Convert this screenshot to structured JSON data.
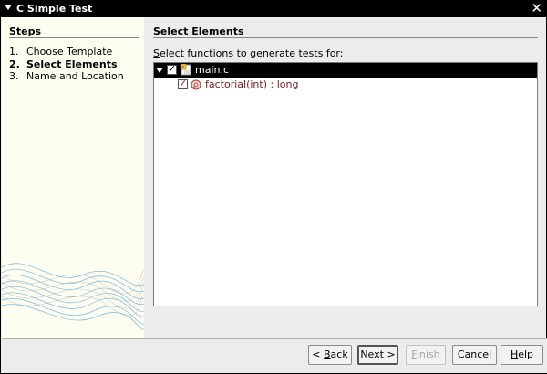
{
  "window": {
    "title": "C Simple Test",
    "close_glyph": "✕"
  },
  "steps": {
    "header": "Steps",
    "items": [
      {
        "num": "1.",
        "label": "Choose Template"
      },
      {
        "num": "2.",
        "label": "Select Elements"
      },
      {
        "num": "3.",
        "label": "Name and Location"
      }
    ],
    "current_index": 1
  },
  "main": {
    "header": "Select Elements",
    "instruction_mnemonic": "S",
    "instruction_rest": "elect functions to generate tests for:"
  },
  "tree": {
    "root": {
      "label": "main.c",
      "checked": true,
      "expanded": true,
      "icon": "c-source-file-icon"
    },
    "children": [
      {
        "label": "factorial(int) : long",
        "checked": true,
        "icon": "function-icon"
      }
    ]
  },
  "buttons": {
    "back_prefix": "< ",
    "back_mnemonic": "B",
    "back_rest": "ack",
    "next": "Next >",
    "finish_mnemonic": "F",
    "finish_rest": "inish",
    "cancel": "Cancel",
    "help_mnemonic": "H",
    "help_rest": "elp"
  },
  "colors": {
    "selection_bg": "#000000",
    "function_text": "#7a1c1c",
    "steps_bg": "#fdfdf0",
    "wave": "#4aa6d8"
  }
}
